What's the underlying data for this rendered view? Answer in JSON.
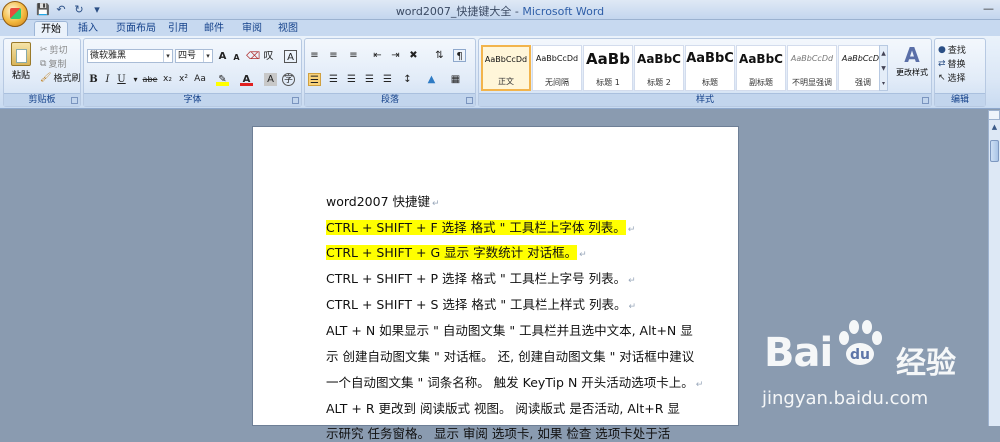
{
  "window": {
    "title": "word2007_快捷键大全",
    "app_name": "Microsoft Word",
    "title_separator": " - "
  },
  "tabs": [
    "开始",
    "插入",
    "页面布局",
    "引用",
    "邮件",
    "审阅",
    "视图"
  ],
  "active_tab": "开始",
  "ribbon": {
    "clipboard": {
      "label": "剪贴板",
      "paste": "粘贴",
      "cut": "剪切",
      "copy": "复制",
      "format_painter": "格式刷"
    },
    "font": {
      "label": "字体",
      "font_name": "微软雅黑",
      "font_size": "四号",
      "bold": "B",
      "italic": "I",
      "underline": "U",
      "strikethrough": "abe",
      "subscript": "x₂",
      "superscript": "x²",
      "change_case": "Aa",
      "grow": "A",
      "shrink": "A",
      "clear": "A",
      "font_color": "A",
      "char_shading": "A"
    },
    "paragraph": {
      "label": "段落"
    },
    "styles": {
      "label": "样式",
      "items": [
        {
          "sample": "AaBbCcDd",
          "name": "正文"
        },
        {
          "sample": "AaBbCcDd",
          "name": "无间隔"
        },
        {
          "sample": "AaBb",
          "name": "标题 1"
        },
        {
          "sample": "AaBbC",
          "name": "标题 2"
        },
        {
          "sample": "AaBbC",
          "name": "标题"
        },
        {
          "sample": "AaBbC",
          "name": "副标题"
        },
        {
          "sample": "AaBbCcDd",
          "name": "不明显强调"
        },
        {
          "sample": "AaBbCcDd",
          "name": "强调"
        }
      ],
      "change_styles": "更改样式"
    },
    "editing": {
      "label": "编辑",
      "find": "查找",
      "replace": "替换",
      "select": "选择"
    }
  },
  "document": {
    "lines": [
      {
        "text": "word2007 快捷键",
        "highlight": false
      },
      {
        "text": "CTRL + SHIFT + F 选择 格式 \" 工具栏上字体 列表。",
        "highlight": true
      },
      {
        "text": "CTRL + SHIFT + G 显示 字数统计 对话框。",
        "highlight": true
      },
      {
        "text": "CTRL + SHIFT + P 选择 格式 \" 工具栏上字号 列表。",
        "highlight": false
      },
      {
        "text": "CTRL + SHIFT + S 选择 格式 \" 工具栏上样式 列表。",
        "highlight": false
      },
      {
        "text": "ALT + N 如果显示 \" 自动图文集 \" 工具栏并且选中文本, Alt+N 显",
        "highlight": false
      },
      {
        "text": "示 创建自动图文集 \" 对话框。 还, 创建自动图文集 \" 对话框中建议",
        "highlight": false
      },
      {
        "text": "一个自动图文集 \" 词条名称。 触发 KeyTip N 开头活动选项卡上。",
        "highlight": false
      },
      {
        "text": "ALT + R 更改到 阅读版式 视图。 阅读版式 是否活动, Alt+R 显",
        "highlight": false
      },
      {
        "text": "示研究 任务窗格。 显示 审阅 选项卡, 如果 检查 选项卡处于活",
        "highlight": false
      }
    ]
  },
  "watermark": {
    "brand": "Bai",
    "brand_tail": "经验",
    "url": "jingyan.baidu.com"
  },
  "colors": {
    "highlight": "#ffff00",
    "ribbon_label": "#15428b",
    "title_app": "#2e5ea8"
  }
}
